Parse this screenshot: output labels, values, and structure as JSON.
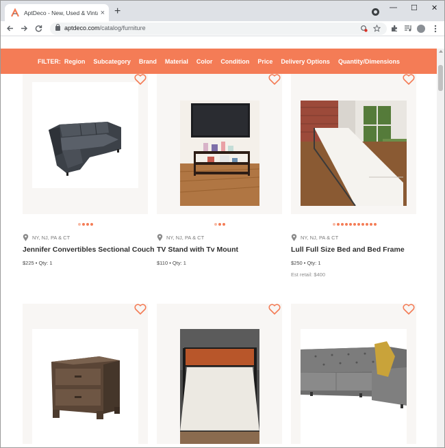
{
  "browser": {
    "tab_title": "AptDeco - New, Used & Vintage",
    "tab_close": "×",
    "new_tab": "+",
    "url_domain": "aptdeco.com",
    "url_path": "/catalog/furniture",
    "window_controls": [
      "—",
      "☐",
      "✕"
    ],
    "icons": [
      "back-icon",
      "forward-icon",
      "reload-icon",
      "lock-icon",
      "star-icon",
      "extensions-icon",
      "media-icon",
      "profile-icon",
      "menu-icon"
    ]
  },
  "filters": {
    "label": "FILTER:",
    "items": [
      "Region",
      "Subcategory",
      "Brand",
      "Material",
      "Color",
      "Condition",
      "Price",
      "Delivery Options",
      "Quantity/Dimensions"
    ]
  },
  "products": [
    {
      "location": "NY, NJ, PA & CT",
      "title": "Jennifer Convertibles Sectional Couch",
      "price": "$225 • Qty: 1",
      "retail": "",
      "image_count": 4
    },
    {
      "location": "NY, NJ, PA & CT",
      "title": "TV Stand with Tv Mount",
      "price": "$110 • Qty: 1",
      "retail": "",
      "image_count": 3
    },
    {
      "location": "NY, NJ, PA & CT",
      "title": "Lull Full Size Bed and Bed Frame",
      "price": "$250 • Qty: 1",
      "retail": "Est retail: $400",
      "image_count": 11
    },
    {
      "location": "",
      "title": "",
      "price": "",
      "retail": "",
      "image_count": 0
    },
    {
      "location": "",
      "title": "",
      "price": "",
      "retail": "",
      "image_count": 0
    },
    {
      "location": "",
      "title": "",
      "price": "",
      "retail": "",
      "image_count": 0
    }
  ],
  "colors": {
    "accent": "#f47c56",
    "card_bg": "#f8f6f4"
  }
}
